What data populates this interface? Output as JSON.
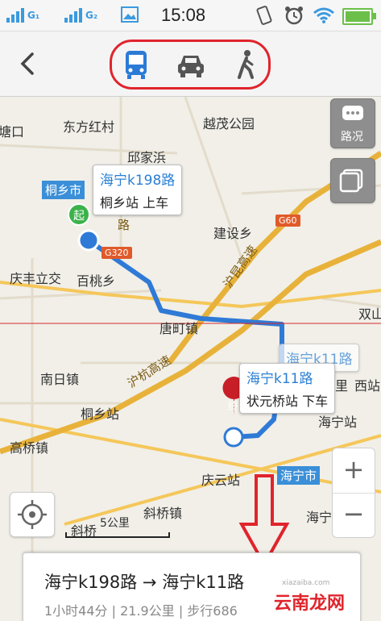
{
  "status_bar": {
    "sim1": "G₁",
    "sim2": "G₂",
    "time": "15:08"
  },
  "toolbar": {
    "back_icon": "chevron-left-icon",
    "modes": [
      "bus-icon",
      "car-icon",
      "walk-icon"
    ],
    "selected_mode": "bus",
    "highlight_color": "#e0242c"
  },
  "map": {
    "places": [
      "塘口",
      "东方红村",
      "越茂公园",
      "邱家浜",
      "建设乡",
      "庆丰立交",
      "百桃乡",
      "唐町镇",
      "南日镇",
      "桐乡站",
      "高桥镇",
      "庆云站",
      "斜桥镇",
      "海宁",
      "双山",
      "西站",
      "二里",
      "海宁站",
      "斜桥"
    ],
    "city_labels": [
      "桐乡市",
      "海宁市"
    ],
    "roads": [
      "G60",
      "G320",
      "沪杭高速",
      "沪昆高速",
      "路"
    ],
    "start_marker": "起",
    "end_marker": "终",
    "start_callout": {
      "line": "海宁k198路",
      "station": "桐乡站 上车"
    },
    "end_callout": {
      "line": "海宁k11路",
      "station": "状元桥站 下车"
    },
    "hidden_callout": "海宁k11路",
    "traffic_button": "路况",
    "layer_icon": "layers-icon",
    "locate_icon": "locate-icon",
    "zoom_in": "+",
    "zoom_out": "−",
    "scale": "5公里",
    "route_color": "#2f7ad6"
  },
  "summary": {
    "route": "海宁k198路 → 海宁k11路",
    "meta": "1小时44分 | 21.9公里 | 步行686"
  },
  "watermark": {
    "text": "云南龙网",
    "sub": "xiazaiba.com"
  },
  "annotation": {
    "arrow_color": "#e0242c"
  }
}
